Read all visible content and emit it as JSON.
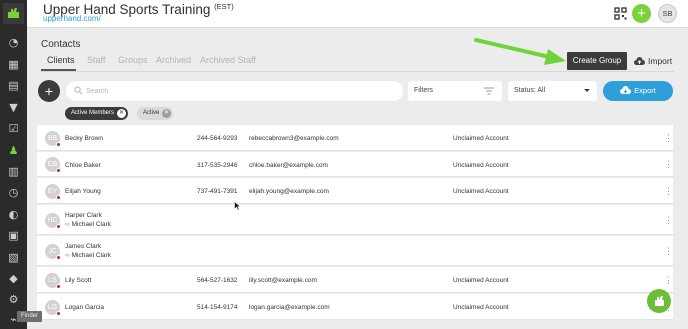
{
  "app": {
    "title": "Upper Hand Sports Training",
    "timezone_superscript": "(EST)",
    "url": "upperhand.com/",
    "avatar_initials": "SB"
  },
  "page": {
    "title": "Contacts",
    "tabs": [
      {
        "label": "Clients",
        "active": true
      },
      {
        "label": "Staff",
        "active": false
      },
      {
        "label": "Groups",
        "active": false
      },
      {
        "label": "Archived",
        "active": false
      },
      {
        "label": "Archived Staff",
        "active": false
      }
    ],
    "create_group_label": "Create Group",
    "import_label": "Import"
  },
  "toolbar": {
    "search_placeholder": "Search",
    "filters_label": "Filters",
    "status_label": "Status: All",
    "export_label": "Export"
  },
  "chips": [
    {
      "label": "Active Members"
    },
    {
      "label": "Active"
    }
  ],
  "contacts": [
    {
      "initials": "BB",
      "name": "Becky Brown",
      "phone": "244-564-9293",
      "email": "rebeccabrown3@example.com",
      "account": "Unclaimed Account"
    },
    {
      "initials": "CB",
      "name": "Chloe Baker",
      "phone": "317-535-2946",
      "email": "chloe.baker@example.com",
      "account": "Unclaimed Account"
    },
    {
      "initials": "EY",
      "name": "Elijah Young",
      "phone": "737-491-7391",
      "email": "elijah.young@example.com",
      "account": "Unclaimed Account"
    },
    {
      "initials": "HC",
      "name": "Harper Clark",
      "phone": "",
      "email": "",
      "account": "",
      "linked": "Michael Clark"
    },
    {
      "initials": "JC",
      "name": "James Clark",
      "phone": "",
      "email": "",
      "account": "",
      "linked": "Michael Clark"
    },
    {
      "initials": "LS",
      "name": "Lily Scott",
      "phone": "564-527-1632",
      "email": "lily.scott@example.com",
      "account": "Unclaimed Account"
    },
    {
      "initials": "LG",
      "name": "Logan Garcia",
      "phone": "514-154-9174",
      "email": "logan.garcia@example.com",
      "account": "Unclaimed Account"
    }
  ],
  "tooltip": {
    "label": "Finder"
  },
  "colors": {
    "accent_green": "#7bd03b",
    "link_blue": "#2f9fd9",
    "dark_button": "#3b3b3b",
    "annotation_arrow": "#6ed43a",
    "alert_dot": "#c62828"
  },
  "rail_icons": [
    "dashboard-icon",
    "calendar-icon",
    "document-icon",
    "shirt-icon",
    "checklist-icon",
    "contacts-icon",
    "chart-icon",
    "clock-icon",
    "gauge-icon",
    "video-icon",
    "report-icon",
    "tag-icon",
    "tag-alt-icon",
    "settings-icon",
    "plug-icon"
  ]
}
